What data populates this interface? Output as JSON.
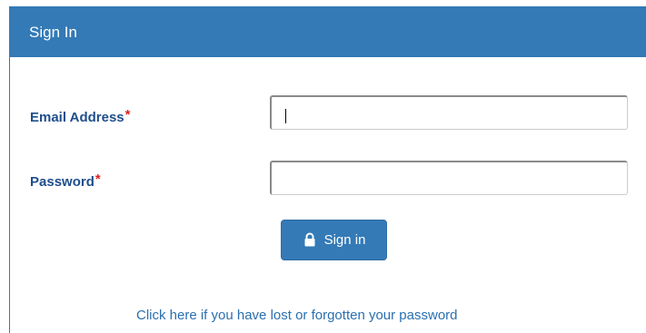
{
  "panel": {
    "title": "Sign In"
  },
  "form": {
    "email": {
      "label": "Email Address",
      "required_marker": "*",
      "value": "",
      "placeholder": ""
    },
    "password": {
      "label": "Password",
      "required_marker": "*",
      "value": "",
      "placeholder": ""
    },
    "submit": {
      "label": "Sign in",
      "icon": "lock-icon"
    },
    "forgot_link": "Click here if you have lost or forgotten your password"
  },
  "colors": {
    "primary": "#337ab7",
    "label": "#1f4e8c",
    "required": "#e02020",
    "link": "#2a6fb0"
  }
}
